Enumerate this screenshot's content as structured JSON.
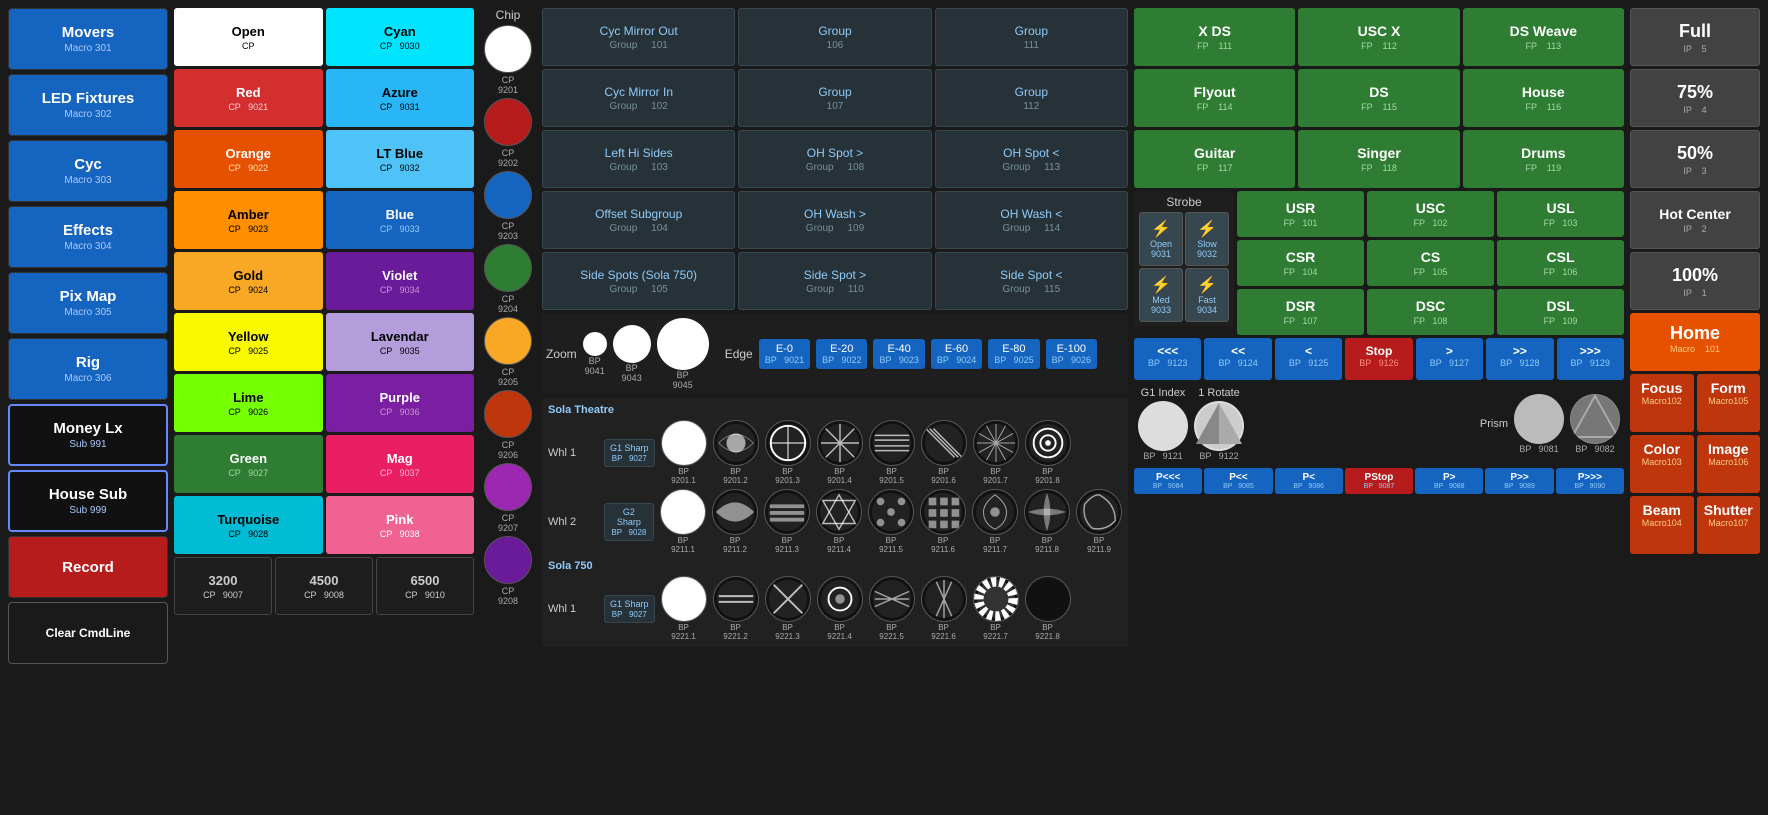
{
  "sidebar": {
    "items": [
      {
        "label": "Movers",
        "sub": "Macro    301"
      },
      {
        "label": "LED Fixtures",
        "sub": "Macro    302"
      },
      {
        "label": "Cyc",
        "sub": "Macro    303"
      },
      {
        "label": "Effects",
        "sub": "Macro    304"
      },
      {
        "label": "Pix Map",
        "sub": "Macro    305"
      },
      {
        "label": "Rig",
        "sub": "Macro    306"
      },
      {
        "label": "Money Lx",
        "sub": "Sub    991"
      },
      {
        "label": "House Sub",
        "sub": "Sub    999"
      },
      {
        "label": "Record",
        "sub": ""
      },
      {
        "label": "Clear CmdLine",
        "sub": ""
      }
    ]
  },
  "colors": {
    "row1": [
      {
        "label": "Open",
        "sub": "CP",
        "class": "white-cell"
      },
      {
        "label": "Cyan",
        "sub": "CP    9030",
        "class": "cyan-cell"
      }
    ],
    "row2": [
      {
        "label": "Red",
        "sub": "CP    9021",
        "class": "red-cell"
      },
      {
        "label": "Azure",
        "sub": "CP    9031",
        "class": "azure-cell"
      }
    ],
    "row3": [
      {
        "label": "Orange",
        "sub": "CP    9022",
        "class": "orange-cell"
      },
      {
        "label": "LT Blue",
        "sub": "CP    9032",
        "class": "ltblue-cell"
      }
    ],
    "row4": [
      {
        "label": "Amber",
        "sub": "CP    9023",
        "class": "amber-cell"
      },
      {
        "label": "Blue",
        "sub": "CP    9033",
        "class": "blue-cell"
      }
    ],
    "row5": [
      {
        "label": "Gold",
        "sub": "CP    9024",
        "class": "gold-cell"
      },
      {
        "label": "Violet",
        "sub": "CP    9034",
        "class": "violet-cell"
      }
    ],
    "row6": [
      {
        "label": "Yellow",
        "sub": "CP    9025",
        "class": "yellow-cell"
      },
      {
        "label": "Lavendar",
        "sub": "CP    9035",
        "class": "lavender-cell"
      }
    ],
    "row7": [
      {
        "label": "Lime",
        "sub": "CP    9026",
        "class": "lime-cell"
      },
      {
        "label": "Purple",
        "sub": "CP    9036",
        "class": "purple-cell"
      }
    ],
    "row8": [
      {
        "label": "Green",
        "sub": "CP    9027",
        "class": "green-cell"
      },
      {
        "label": "Mag",
        "sub": "CP    9037",
        "class": "mag-cell"
      }
    ],
    "row9": [
      {
        "label": "Turquoise",
        "sub": "CP    9028",
        "class": "turquoise-cell"
      },
      {
        "label": "Pink",
        "sub": "CP    9038",
        "class": "pink-cell"
      }
    ],
    "row10": [
      {
        "label": "3200",
        "sub": "CP    9007",
        "class": "num-cell"
      },
      {
        "label": "4500",
        "sub": "CP    9008",
        "class": "num-cell"
      },
      {
        "label": "6500",
        "sub": "CP    9010",
        "class": "num-cell"
      }
    ]
  },
  "chips": [
    {
      "label": "CP\n9201",
      "color": "white"
    },
    {
      "label": "CP\n9202",
      "color": "#b71c1c"
    },
    {
      "label": "CP\n9203",
      "color": "#1565c0"
    },
    {
      "label": "CP\n9204",
      "color": "#2e7d32"
    },
    {
      "label": "CP\n9205",
      "color": "#f9a825"
    },
    {
      "label": "CP\n9206",
      "color": "#bf360c"
    },
    {
      "label": "CP\n9207",
      "color": "#9c27b0"
    },
    {
      "label": "CP\n9208",
      "color": "#6a1b9a"
    }
  ],
  "groups": {
    "top": [
      {
        "title": "Cyc Mirror Out",
        "sub": "Group    101"
      },
      {
        "title": "Group",
        "sub": "106"
      },
      {
        "title": "Group",
        "sub": "111"
      }
    ],
    "row2": [
      {
        "title": "Cyc Mirror In",
        "sub": "Group    102"
      },
      {
        "title": "Group",
        "sub": "107"
      },
      {
        "title": "Group",
        "sub": "112"
      }
    ],
    "row3": [
      {
        "title": "Left Hi Sides",
        "sub": "Group    103"
      },
      {
        "title": "OH Spot >",
        "sub": "Group    108"
      },
      {
        "title": "OH Spot <",
        "sub": "Group    113"
      }
    ],
    "row4": [
      {
        "title": "Offset Subgroup",
        "sub": "Group    104"
      },
      {
        "title": "OH Wash >",
        "sub": "Group    109"
      },
      {
        "title": "OH Wash <",
        "sub": "Group    114"
      }
    ],
    "row5": [
      {
        "title": "Side Spots (Sola 750)",
        "sub": "Group    105"
      },
      {
        "title": "Side Spot >",
        "sub": "Group    110"
      },
      {
        "title": "Side Spot <",
        "sub": "Group    115"
      }
    ]
  },
  "zoom": {
    "label": "Zoom",
    "circles": [
      {
        "size": 24,
        "sub": "BP\n9041"
      },
      {
        "size": 38,
        "sub": "BP\n9043"
      },
      {
        "size": 52,
        "sub": "BP\n9045"
      }
    ]
  },
  "edge": {
    "label": "Edge",
    "buttons": [
      {
        "title": "E-0",
        "sub": "BP    9021"
      },
      {
        "title": "E-20",
        "sub": "BP    9022"
      },
      {
        "title": "E-40",
        "sub": "BP    9023"
      },
      {
        "title": "E-60",
        "sub": "BP    9024"
      },
      {
        "title": "E-80",
        "sub": "BP    9025"
      },
      {
        "title": "E-100",
        "sub": "BP    9026"
      }
    ]
  },
  "green_panel": {
    "row1": [
      {
        "title": "X DS",
        "sub": "FP    111"
      },
      {
        "title": "USC X",
        "sub": "FP    112"
      },
      {
        "title": "DS Weave",
        "sub": "FP    113"
      }
    ],
    "row2": [
      {
        "title": "Flyout",
        "sub": "FP    114"
      },
      {
        "title": "DS",
        "sub": "FP    115"
      },
      {
        "title": "House",
        "sub": "FP    116"
      }
    ],
    "row3": [
      {
        "title": "Guitar",
        "sub": "FP    117"
      },
      {
        "title": "Singer",
        "sub": "FP    118"
      },
      {
        "title": "Drums",
        "sub": "FP    119"
      }
    ]
  },
  "strobe": {
    "label": "Strobe",
    "buttons": [
      {
        "title": "Open",
        "sub": "9031"
      },
      {
        "title": "Slow",
        "sub": "9032"
      },
      {
        "title": "Med",
        "sub": "9033"
      },
      {
        "title": "Fast",
        "sub": "9034"
      }
    ]
  },
  "fp_grid": {
    "row1": [
      {
        "title": "USR",
        "sub": "FP    101"
      },
      {
        "title": "USC",
        "sub": "FP    102"
      },
      {
        "title": "USL",
        "sub": "FP    103"
      }
    ],
    "row2": [
      {
        "title": "CSR",
        "sub": "FP    104"
      },
      {
        "title": "CS",
        "sub": "FP    105"
      },
      {
        "title": "CSL",
        "sub": "FP    106"
      }
    ],
    "row3": [
      {
        "title": "DSR",
        "sub": "FP    107"
      },
      {
        "title": "DSC",
        "sub": "FP    108"
      },
      {
        "title": "DSL",
        "sub": "FP    109"
      }
    ]
  },
  "nav": {
    "buttons": [
      {
        "title": "<<<",
        "sub": "BP    9123"
      },
      {
        "title": "<<",
        "sub": "BP    9124"
      },
      {
        "title": "<",
        "sub": "BP    9125"
      },
      {
        "title": "Stop",
        "sub": "BP    9126"
      },
      {
        "title": ">",
        "sub": "BP    9127"
      },
      {
        "title": ">>",
        "sub": "BP    9128"
      },
      {
        "title": ">>>",
        "sub": "BP    9129"
      }
    ]
  },
  "g1_index": {
    "label": "G1 Index",
    "sub": "BP    9121",
    "rotate_label": "1 Rotate",
    "rotate_sub": "BP    9122"
  },
  "prism": {
    "label": "Prism",
    "circle1_sub": "BP\n9081",
    "circle2_sub": "BP\n9082"
  },
  "p_buttons": {
    "row1": [
      {
        "title": "P<<<",
        "sub": "BP    9084"
      },
      {
        "title": "P<<",
        "sub": "BP    9085"
      },
      {
        "title": "P<",
        "sub": "BP    9086"
      },
      {
        "title": "PStop",
        "sub": "BP    9087"
      },
      {
        "title": "P>",
        "sub": "BP    9088"
      },
      {
        "title": "P>>",
        "sub": "BP    9089"
      },
      {
        "title": "P>>>",
        "sub": "BP    9090"
      }
    ]
  },
  "ip_panel": {
    "buttons": [
      {
        "title": "Full",
        "sub": "IP    5"
      },
      {
        "title": "75%",
        "sub": "IP    4"
      },
      {
        "title": "50%",
        "sub": "IP    3"
      },
      {
        "title": "Hot Center",
        "sub": "IP    2"
      },
      {
        "title": "100%",
        "sub": "IP    1"
      }
    ]
  },
  "macro_panel": {
    "home": {
      "title": "Home",
      "sub": "Macro    101"
    },
    "focus": {
      "title": "Focus",
      "sub": "Macro102"
    },
    "form": {
      "title": "Form",
      "sub": "Macro105"
    },
    "color": {
      "title": "Color",
      "sub": "Macro103"
    },
    "image": {
      "title": "Image",
      "sub": "Macro106"
    },
    "beam": {
      "title": "Beam",
      "sub": "Macro104"
    },
    "shutter": {
      "title": "Shutter",
      "sub": "Macro107"
    }
  },
  "sola_theatre": {
    "section_label": "Sola Theatre",
    "whl1_label": "Whl 1",
    "whl2_label": "Whl 2",
    "g1_sharp_label": "G1 Sharp",
    "g2_sharp_label": "G2 Sharp",
    "whl1_gobos": [
      {
        "sub": "BP\n9201.1"
      },
      {
        "sub": "BP\n9201.2"
      },
      {
        "sub": "BP\n9201.3"
      },
      {
        "sub": "BP\n9201.4"
      },
      {
        "sub": "BP\n9201.5"
      },
      {
        "sub": "BP\n9201.6"
      },
      {
        "sub": "BP\n9201.7"
      },
      {
        "sub": "BP\n9201.8"
      }
    ],
    "whl2_gobos": [
      {
        "sub": "BP\n9211.1"
      },
      {
        "sub": "BP\n9211.2"
      },
      {
        "sub": "BP\n9211.3"
      },
      {
        "sub": "BP\n9211.4"
      },
      {
        "sub": "BP\n9211.5"
      },
      {
        "sub": "BP\n9211.6"
      },
      {
        "sub": "BP\n9211.7"
      },
      {
        "sub": "BP\n9211.8"
      },
      {
        "sub": "BP\n9211.9"
      }
    ]
  },
  "sola_750": {
    "section_label": "Sola 750",
    "whl1_label": "Whl 1",
    "g1_sharp_label": "G1 Sharp",
    "whl1_gobos": [
      {
        "sub": "BP\n9221.1"
      },
      {
        "sub": "BP\n9221.2"
      },
      {
        "sub": "BP\n9221.3"
      },
      {
        "sub": "BP\n9221.4"
      },
      {
        "sub": "BP\n9221.5"
      },
      {
        "sub": "BP\n9221.6"
      },
      {
        "sub": "BP\n9221.7"
      },
      {
        "sub": "BP\n9221.8"
      }
    ]
  }
}
